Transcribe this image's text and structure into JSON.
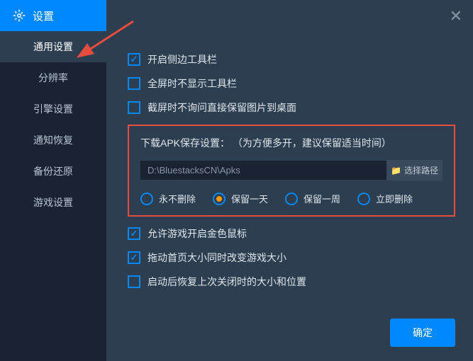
{
  "header": {
    "title": "设置"
  },
  "sidebar": {
    "items": [
      {
        "label": "通用设置"
      },
      {
        "label": "分辨率"
      },
      {
        "label": "引擎设置"
      },
      {
        "label": "通知恢复"
      },
      {
        "label": "备份还原"
      },
      {
        "label": "游戏设置"
      }
    ]
  },
  "checks": {
    "c1": "开启侧边工具栏",
    "c2": "全屏时不显示工具栏",
    "c3": "截屏时不询问直接保留图片到桌面",
    "c4": "允许游戏开启金色鼠标",
    "c5": "拖动首页大小同时改变游戏大小",
    "c6": "启动后恢复上次关闭时的大小和位置"
  },
  "apk": {
    "title": "下载APK保存设置：  （为方便多开，建议保留适当时间）",
    "path": "D:\\BluestacksCN\\Apks",
    "browse": "选择路径",
    "options": [
      {
        "label": "永不删除"
      },
      {
        "label": "保留一天"
      },
      {
        "label": "保留一周"
      },
      {
        "label": "立即删除"
      }
    ]
  },
  "confirm": "确定"
}
